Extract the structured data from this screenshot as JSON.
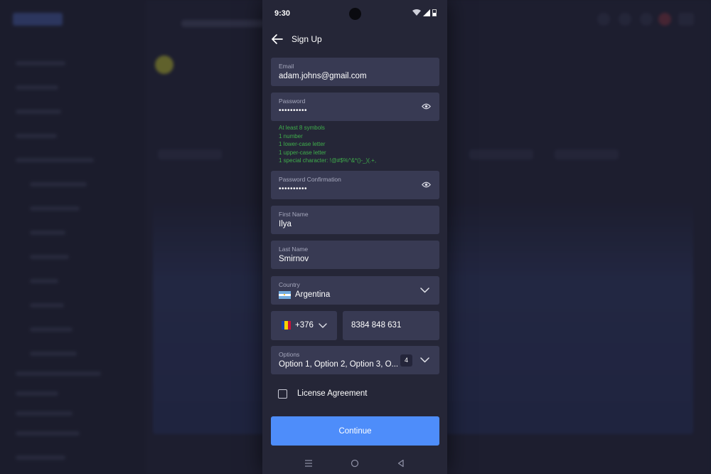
{
  "status_bar": {
    "time": "9:30"
  },
  "header": {
    "title": "Sign Up"
  },
  "form": {
    "email": {
      "label": "Email",
      "value": "adam.johns@gmail.com"
    },
    "password": {
      "label": "Password",
      "value": "••••••••••",
      "hints": [
        "At least 8 symbols",
        "1 number",
        "1 lower-case letter",
        "1 upper-case letter",
        "1 special character: !@#$%^&*()-_)(.+,"
      ]
    },
    "password_confirmation": {
      "label": "Password Confirmation",
      "value": "••••••••••"
    },
    "first_name": {
      "label": "First Name",
      "value": "Ilya"
    },
    "last_name": {
      "label": "Last Name",
      "value": "Smirnov"
    },
    "country": {
      "label": "Country",
      "value": "Argentina"
    },
    "phone": {
      "code": "+376",
      "number": "8384 848 631"
    },
    "options": {
      "label": "Options",
      "value": "Option 1, Option 2, Option 3, O...",
      "count": "4"
    },
    "license_agreement": {
      "label": "License Agreement",
      "checked": false
    },
    "continue_label": "Continue"
  },
  "colors": {
    "accent": "#4e8dfa",
    "field_bg": "#383a53",
    "phone_bg": "#252637",
    "hint_green": "#3fae4b"
  },
  "icons": {
    "back": "arrow-left-icon",
    "eye": "eye-icon",
    "chevron": "chevron-down-icon",
    "nav_menu": "menu-icon",
    "nav_home": "circle-home-icon",
    "nav_back": "triangle-back-icon"
  }
}
